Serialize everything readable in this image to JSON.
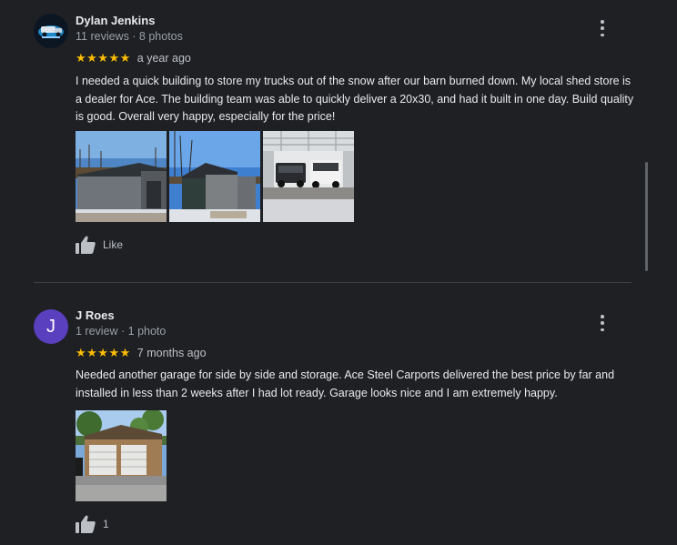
{
  "reviews": [
    {
      "name": "Dylan Jenkins",
      "meta": "11 reviews · 8 photos",
      "stars": "★★★★★",
      "rating": 5,
      "time": "a year ago",
      "text": "I needed a quick building to store my trucks out of the snow after our barn burned down. My local shed store is a dealer for Ace. The building team was able to quickly deliver a 20x30, and had it built in one day. Build quality is good. Overall very happy, especially for the price!",
      "like_label": "Like",
      "avatar_icon": "truck-logo"
    },
    {
      "name": "J Roes",
      "meta": "1 review · 1 photo",
      "stars": "★★★★★",
      "rating": 5,
      "time": "7 months ago",
      "text": "Needed another garage for side by side and storage. Ace Steel Carports delivered the best price by far and installed in less than 2 weeks after I had lot ready. Garage looks nice and I am extremely happy.",
      "like_label": "1",
      "avatar_letter": "J"
    }
  ],
  "colors": {
    "background": "#1f2023",
    "star": "#fbbc04",
    "avatar_letter_bg": "#5a3fbf"
  }
}
